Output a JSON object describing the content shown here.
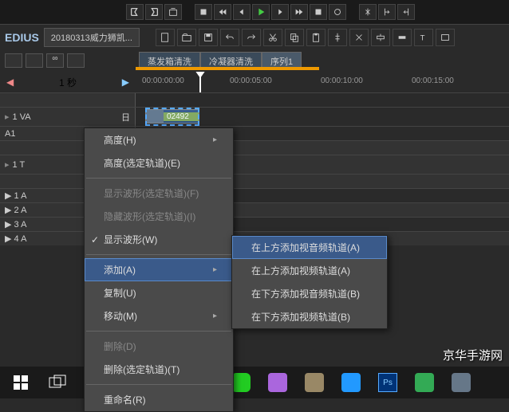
{
  "app": {
    "name": "EDIUS",
    "project_tab": "20180313威力狮凯..."
  },
  "sequence_tabs": [
    "蒸发箱清洗",
    "冷凝器清洗",
    "序列1"
  ],
  "time_display": {
    "left": "◀",
    "value": "1 秒",
    "right": "▶"
  },
  "ruler": {
    "tc0": "00:00:00:00",
    "tc1": "00:00:05:00",
    "tc2": "00:00:10:00",
    "tc3": "00:00:15:00"
  },
  "tracks": {
    "va_label": "1 VA",
    "va_right": "日",
    "a_label": "A1",
    "t_label": "1 T",
    "a1": "▶ 1 A",
    "a2": "▶ 2 A",
    "a3": "▶ 3 A",
    "a4": "▶ 4 A"
  },
  "clip": {
    "name1": "02492"
  },
  "context_menu": {
    "height": "高度(H)",
    "height_sel": "高度(选定轨道)(E)",
    "show_wave_sel": "显示波形(选定轨道)(F)",
    "hide_wave_sel": "隐藏波形(选定轨道)(I)",
    "show_wave": "显示波形(W)",
    "add": "添加(A)",
    "copy": "复制(U)",
    "move": "移动(M)",
    "delete": "删除(D)",
    "delete_sel": "删除(选定轨道)(T)",
    "rename": "重命名(R)"
  },
  "submenu": {
    "add_av_above": "在上方添加视音频轨道(A)",
    "add_v_above": "在上方添加视频轨道(A)",
    "add_av_below": "在下方添加视音频轨道(B)",
    "add_v_below": "在下方添加视频轨道(B)"
  },
  "watermark": "京华手游网",
  "colors": {
    "accent": "#3a5a8a",
    "play": "#4c4"
  }
}
